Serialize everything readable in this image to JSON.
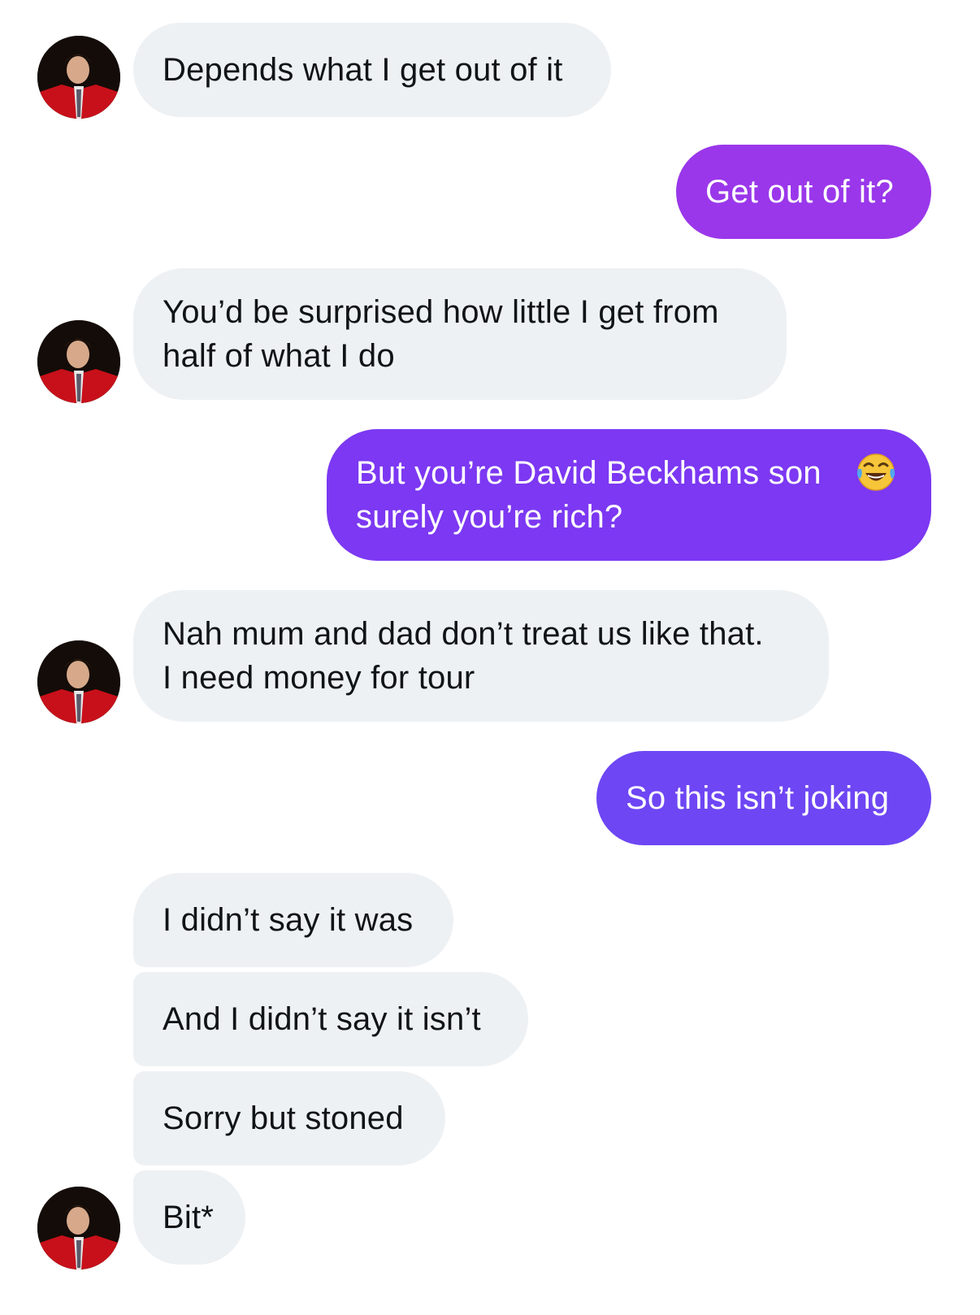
{
  "conversation": {
    "messages": [
      {
        "sender": "them",
        "text": "Depends what I get out of it",
        "avatar": true
      },
      {
        "sender": "me",
        "text": "Get out of it?"
      },
      {
        "sender": "them",
        "text": "You’d be surprised how little I get from\nhalf of what I do",
        "avatar": true
      },
      {
        "sender": "me",
        "text": "But you’re David Beckhams son\nsurely you’re rich?",
        "emoji": "face-with-tears-of-joy"
      },
      {
        "sender": "them",
        "text": "Nah mum and dad don’t treat us like that.\nI need money for tour",
        "avatar": true
      },
      {
        "sender": "me",
        "text": "So this isn’t joking"
      },
      {
        "sender": "them",
        "text": "I didn’t say it was"
      },
      {
        "sender": "them",
        "text": "And I didn’t say it isn’t"
      },
      {
        "sender": "them",
        "text": "Sorry but stoned"
      },
      {
        "sender": "them",
        "text": "Bit*",
        "avatar": true
      }
    ]
  },
  "colors": {
    "incoming_bubble": "#eef1f4",
    "incoming_text": "#101418",
    "outgoing_text": "#ffffff",
    "outgoing_gradient_top": "#9a37ea",
    "outgoing_gradient_mid": "#7c38f2",
    "outgoing_gradient_bottom": "#6e46f4"
  }
}
